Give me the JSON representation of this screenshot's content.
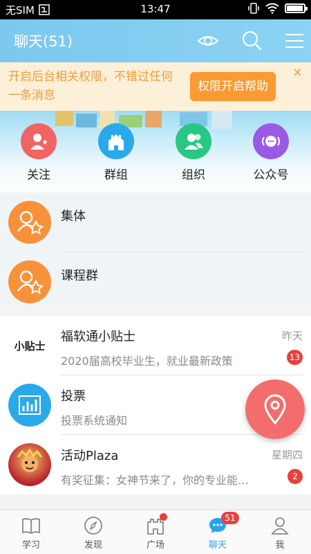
{
  "status_bar": {
    "carrier": "无SIM",
    "time": "13:47",
    "battery_level": 0.95
  },
  "header": {
    "title": "聊天(51)"
  },
  "notice": {
    "text": "开启后台相关权限，不错过任何一条消息",
    "button": "权限开启帮助",
    "close": "×"
  },
  "quick_actions": [
    {
      "label": "关注",
      "color": "#f26464",
      "icon": "follow-icon"
    },
    {
      "label": "群组",
      "color": "#2aa9ea",
      "icon": "group-icon"
    },
    {
      "label": "组织",
      "color": "#27c883",
      "icon": "organization-icon"
    },
    {
      "label": "公众号",
      "color": "#9a5ae6",
      "icon": "public-account-icon"
    }
  ],
  "groups": [
    {
      "name": "集体"
    },
    {
      "name": "课程群"
    }
  ],
  "chats": [
    {
      "name": "福软通小贴士",
      "preview": "2020届高校毕业生，就业最新政策",
      "time": "昨天",
      "badge": "13",
      "avatar_text": "小贴士"
    },
    {
      "name": "投票",
      "preview": "投票系统通知",
      "time": "",
      "badge": ""
    },
    {
      "name": "活动Plaza",
      "preview": "有奖征集：女神节来了，你的专业能…",
      "time": "星期四",
      "badge": "2"
    }
  ],
  "bottom_nav": [
    {
      "label": "学习",
      "icon": "book-icon"
    },
    {
      "label": "发现",
      "icon": "compass-icon"
    },
    {
      "label": "广场",
      "icon": "castle-icon"
    },
    {
      "label": "聊天",
      "icon": "chat-icon",
      "badge": "51"
    },
    {
      "label": "我",
      "icon": "person-icon"
    }
  ],
  "colors": {
    "header": "#7cc8ef",
    "accent": "#2aa3e8",
    "notice_text": "#f39a3b",
    "badge": "#e8413c",
    "fab": "#f36d6d"
  }
}
